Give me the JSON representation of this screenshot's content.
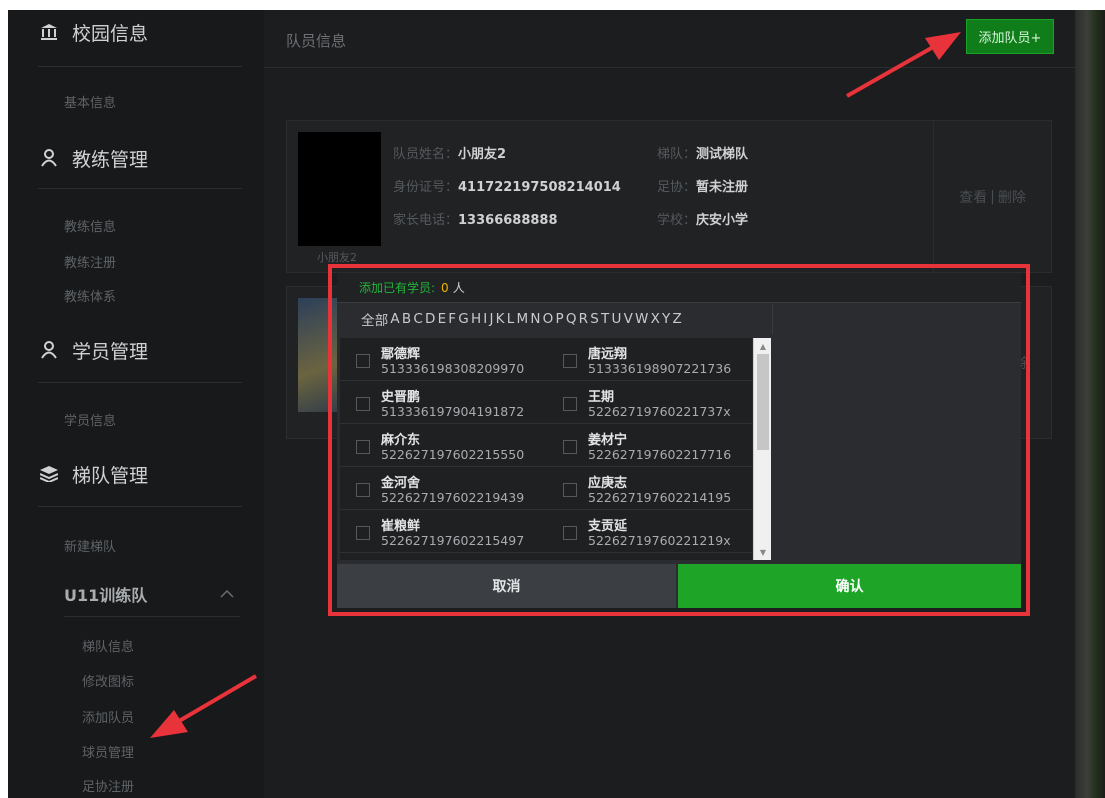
{
  "sidebar": {
    "campus": {
      "title": "校园信息",
      "icon": "building-icon",
      "items": [
        "基本信息"
      ]
    },
    "coach": {
      "title": "教练管理",
      "icon": "user-icon",
      "items": [
        "教练信息",
        "教练注册",
        "教练体系"
      ]
    },
    "student": {
      "title": "学员管理",
      "icon": "user-icon",
      "items": [
        "学员信息"
      ]
    },
    "team": {
      "title": "梯队管理",
      "icon": "stack-icon",
      "items": [
        "新建梯队"
      ]
    },
    "group": {
      "title": "U11训练队",
      "chevron": "chevron-up-icon",
      "items": [
        "梯队信息",
        "修改图标",
        "添加队员",
        "球员管理",
        "足协注册"
      ]
    }
  },
  "main": {
    "title": "队员信息",
    "add_button": "添加队员+",
    "card": {
      "name_label": "队员姓名：",
      "name": "小朋友2",
      "id_label": "身份证号：",
      "id": "411722197508214014",
      "phone_label": "家长电话：",
      "phone": "13366688888",
      "team_label": "梯队：",
      "team": "测试梯队",
      "fa_label": "足协：",
      "fa": "暂未注册",
      "school_label": "学校：",
      "school": "庆安小学",
      "caption": "小朋友2",
      "view": "查看",
      "sep": "|",
      "delete": "删除"
    },
    "card2_action": "删除"
  },
  "modal": {
    "header_label": "添加已有学员:",
    "count": "0",
    "unit": "人",
    "alphabet_all": "全部",
    "letters": [
      "A",
      "B",
      "C",
      "D",
      "E",
      "F",
      "G",
      "H",
      "I",
      "J",
      "K",
      "L",
      "M",
      "N",
      "O",
      "P",
      "Q",
      "R",
      "S",
      "T",
      "U",
      "V",
      "W",
      "X",
      "Y",
      "Z"
    ],
    "rows": [
      [
        {
          "name": "鄢德辉",
          "id": "513336198308209970"
        },
        {
          "name": "唐远翔",
          "id": "513336198907221736"
        }
      ],
      [
        {
          "name": "史晋鹏",
          "id": "513336197904191872"
        },
        {
          "name": "王期",
          "id": "52262719760221737x"
        }
      ],
      [
        {
          "name": "麻介东",
          "id": "522627197602215550"
        },
        {
          "name": "姜材宁",
          "id": "522627197602217716"
        }
      ],
      [
        {
          "name": "金河舍",
          "id": "522627197602219439"
        },
        {
          "name": "应庚志",
          "id": "522627197602214195"
        }
      ],
      [
        {
          "name": "崔粮鲜",
          "id": "522627197602215497"
        },
        {
          "name": "支贡延",
          "id": "52262719760221219x"
        }
      ]
    ],
    "cancel": "取消",
    "confirm": "确认"
  },
  "colors": {
    "accent_green": "#1ea528",
    "highlight_red": "#e8333a",
    "count_yellow": "#f0b400"
  }
}
